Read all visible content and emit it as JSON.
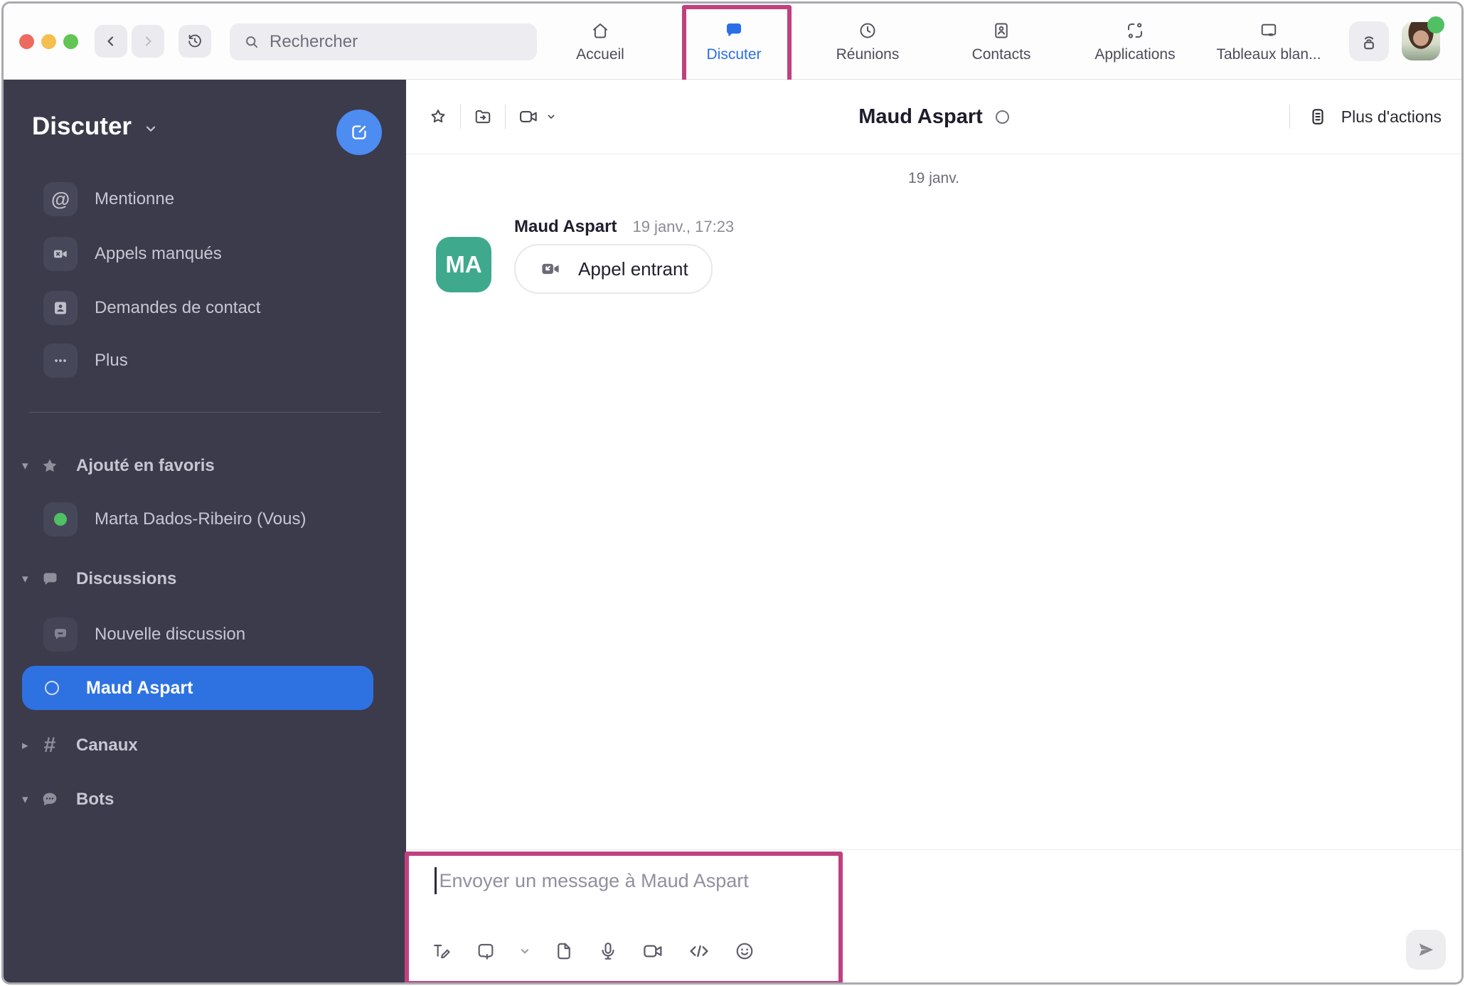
{
  "colors": {
    "accent_blue": "#2b6fe6",
    "selected_blue": "#2e72e2",
    "compose_blue": "#4d8cf1",
    "sidebar_bg": "#3b3b4c",
    "annotation_pink": "#c0417f",
    "avatar_teal": "#3fa98d",
    "presence_green": "#4fc162"
  },
  "topbar": {
    "window_controls": [
      "close-button",
      "minimize-button",
      "maximize-button"
    ],
    "nav_icons": [
      "chevron-left-icon",
      "chevron-right-icon",
      "history-icon"
    ],
    "search_placeholder": "Rechercher",
    "tabs": [
      {
        "label": "Accueil",
        "icon": "home-icon",
        "active": false
      },
      {
        "label": "Discuter",
        "icon": "chat-bubble-icon",
        "active": true,
        "annotated": true
      },
      {
        "label": "Réunions",
        "icon": "clock-icon",
        "active": false
      },
      {
        "label": "Contacts",
        "icon": "contact-card-icon",
        "active": false
      },
      {
        "label": "Applications",
        "icon": "apps-icon",
        "active": false
      },
      {
        "label": "Tableaux blan...",
        "icon": "whiteboard-icon",
        "active": false
      }
    ],
    "right_icons": [
      "share-to-device-icon",
      "user-avatar",
      "presence-dot"
    ]
  },
  "sidebar": {
    "title": "Discuter",
    "compose_icon": "compose-icon",
    "shortcuts": [
      {
        "label": "Mentionne",
        "icon": "at-sign-icon"
      },
      {
        "label": "Appels manqués",
        "icon": "missed-video-call-icon"
      },
      {
        "label": "Demandes de contact",
        "icon": "contact-request-icon"
      },
      {
        "label": "Plus",
        "icon": "ellipsis-icon"
      }
    ],
    "favorites": {
      "header": "Ajouté en favoris",
      "icon": "star-icon",
      "items": [
        {
          "label": "Marta Dados-Ribeiro  (Vous)",
          "presence": "online"
        }
      ]
    },
    "discussions": {
      "header": "Discussions",
      "icon": "chat-bubble-icon",
      "items": [
        {
          "label": "Nouvelle discussion",
          "icon": "chat-bubble-icon",
          "selected": false
        },
        {
          "label": "Maud Aspart",
          "icon": "status-ring-icon",
          "selected": true
        }
      ]
    },
    "channels": {
      "header": "Canaux",
      "icon": "hash-icon",
      "collapsed": true
    },
    "bots": {
      "header": "Bots",
      "icon": "bot-bubble-icon",
      "collapsed": false
    }
  },
  "chat": {
    "title": "Maud Aspart",
    "status_icon": "status-ring-icon",
    "toolbar_icons": [
      "star-icon",
      "folder-move-icon",
      "video-call-icon",
      "chevron-down-icon"
    ],
    "more_actions_label": "Plus d'actions",
    "more_actions_icon": "list-icon",
    "date_separator": "19 janv.",
    "message": {
      "sender": "Maud Aspart",
      "timestamp": "19 janv., 17:23",
      "avatar_initials": "MA",
      "call_chip_label": "Appel entrant",
      "call_chip_icon": "incoming-video-call-icon"
    }
  },
  "composer": {
    "placeholder": "Envoyer un message à Maud Aspart",
    "toolbar_icons": [
      "format-text-icon",
      "screenshot-icon",
      "chevron-down-icon",
      "file-icon",
      "microphone-icon",
      "video-icon",
      "code-icon",
      "emoji-icon"
    ],
    "send_icon": "send-icon"
  }
}
